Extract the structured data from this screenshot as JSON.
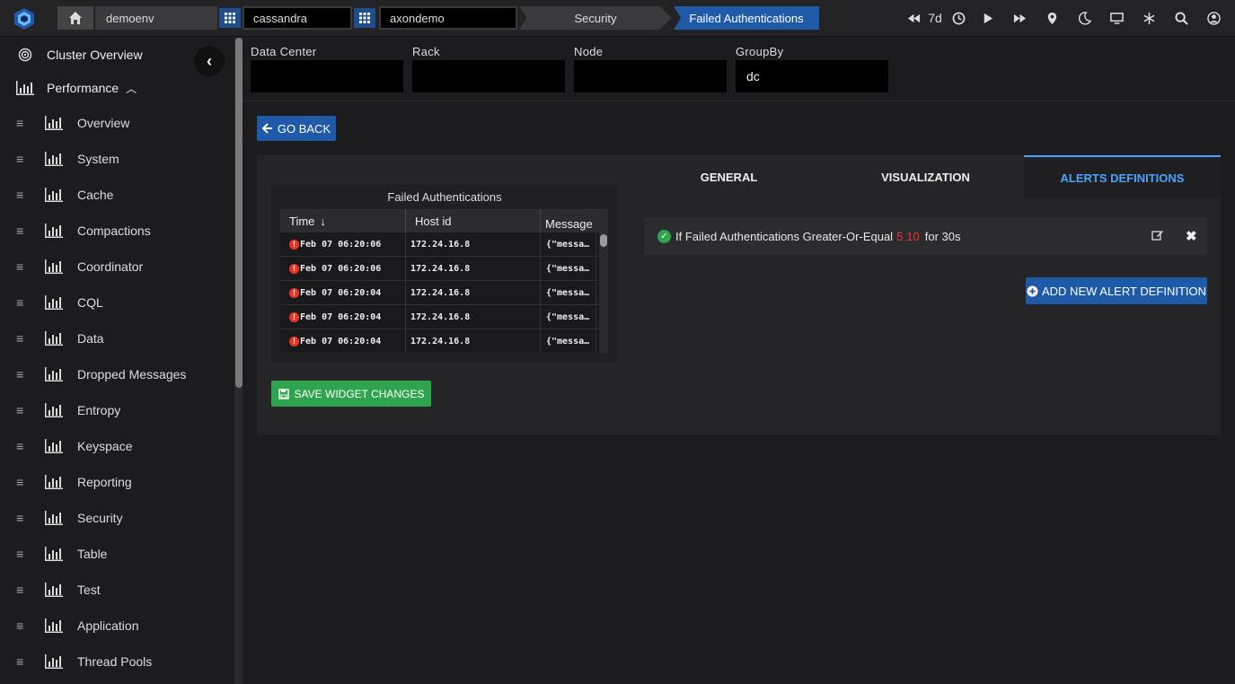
{
  "breadcrumb": {
    "env": "demoenv",
    "cluster_type": "cassandra",
    "cluster": "axondemo",
    "section": "Security",
    "page": "Failed Authentications"
  },
  "toolbar": {
    "range_label": "7d"
  },
  "sidebar": {
    "cluster_overview": "Cluster Overview",
    "performance": "Performance",
    "items": [
      "Overview",
      "System",
      "Cache",
      "Compactions",
      "Coordinator",
      "CQL",
      "Data",
      "Dropped Messages",
      "Entropy",
      "Keyspace",
      "Reporting",
      "Security",
      "Table",
      "Test",
      "Application",
      "Thread Pools"
    ]
  },
  "filters": {
    "dc_label": "Data Center",
    "dc_value": "",
    "rack_label": "Rack",
    "rack_value": "",
    "node_label": "Node",
    "node_value": "",
    "groupby_label": "GroupBy",
    "groupby_value": "dc"
  },
  "go_back": "GO BACK",
  "widget": {
    "title": "Failed Authentications",
    "columns": [
      "Time",
      "Host id",
      "Message"
    ],
    "rows": [
      {
        "time": "Feb 07 06:20:06",
        "host": "172.24.16.8",
        "msg": "{\"messa…"
      },
      {
        "time": "Feb 07 06:20:06",
        "host": "172.24.16.8",
        "msg": "{\"messa…"
      },
      {
        "time": "Feb 07 06:20:04",
        "host": "172.24.16.8",
        "msg": "{\"messa…"
      },
      {
        "time": "Feb 07 06:20:04",
        "host": "172.24.16.8",
        "msg": "{\"messa…"
      },
      {
        "time": "Feb 07 06:20:04",
        "host": "172.24.16.8",
        "msg": "{\"messa…"
      }
    ]
  },
  "save_changes": "SAVE WIDGET CHANGES",
  "tabs": {
    "general": "GENERAL",
    "visualization": "VISUALIZATION",
    "alerts": "ALERTS DEFINITIONS"
  },
  "alert": {
    "prefix": "If Failed Authentications Greater-Or-Equal",
    "warn": "5",
    "crit": "10",
    "suffix": "for 30s"
  },
  "add_alert": "ADD NEW ALERT DEFINITION",
  "colors": {
    "accent": "#1e5aa8",
    "success": "#2ea44f",
    "danger": "#ee3333",
    "tab_active": "#4aa3ff"
  }
}
